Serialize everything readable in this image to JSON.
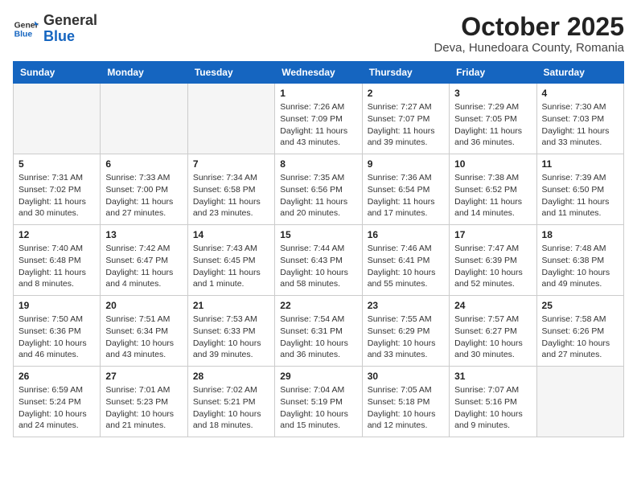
{
  "header": {
    "logo_general": "General",
    "logo_blue": "Blue",
    "month_title": "October 2025",
    "location": "Deva, Hunedoara County, Romania"
  },
  "days_of_week": [
    "Sunday",
    "Monday",
    "Tuesday",
    "Wednesday",
    "Thursday",
    "Friday",
    "Saturday"
  ],
  "weeks": [
    [
      {
        "day": "",
        "info": ""
      },
      {
        "day": "",
        "info": ""
      },
      {
        "day": "",
        "info": ""
      },
      {
        "day": "1",
        "info": "Sunrise: 7:26 AM\nSunset: 7:09 PM\nDaylight: 11 hours and 43 minutes."
      },
      {
        "day": "2",
        "info": "Sunrise: 7:27 AM\nSunset: 7:07 PM\nDaylight: 11 hours and 39 minutes."
      },
      {
        "day": "3",
        "info": "Sunrise: 7:29 AM\nSunset: 7:05 PM\nDaylight: 11 hours and 36 minutes."
      },
      {
        "day": "4",
        "info": "Sunrise: 7:30 AM\nSunset: 7:03 PM\nDaylight: 11 hours and 33 minutes."
      }
    ],
    [
      {
        "day": "5",
        "info": "Sunrise: 7:31 AM\nSunset: 7:02 PM\nDaylight: 11 hours and 30 minutes."
      },
      {
        "day": "6",
        "info": "Sunrise: 7:33 AM\nSunset: 7:00 PM\nDaylight: 11 hours and 27 minutes."
      },
      {
        "day": "7",
        "info": "Sunrise: 7:34 AM\nSunset: 6:58 PM\nDaylight: 11 hours and 23 minutes."
      },
      {
        "day": "8",
        "info": "Sunrise: 7:35 AM\nSunset: 6:56 PM\nDaylight: 11 hours and 20 minutes."
      },
      {
        "day": "9",
        "info": "Sunrise: 7:36 AM\nSunset: 6:54 PM\nDaylight: 11 hours and 17 minutes."
      },
      {
        "day": "10",
        "info": "Sunrise: 7:38 AM\nSunset: 6:52 PM\nDaylight: 11 hours and 14 minutes."
      },
      {
        "day": "11",
        "info": "Sunrise: 7:39 AM\nSunset: 6:50 PM\nDaylight: 11 hours and 11 minutes."
      }
    ],
    [
      {
        "day": "12",
        "info": "Sunrise: 7:40 AM\nSunset: 6:48 PM\nDaylight: 11 hours and 8 minutes."
      },
      {
        "day": "13",
        "info": "Sunrise: 7:42 AM\nSunset: 6:47 PM\nDaylight: 11 hours and 4 minutes."
      },
      {
        "day": "14",
        "info": "Sunrise: 7:43 AM\nSunset: 6:45 PM\nDaylight: 11 hours and 1 minute."
      },
      {
        "day": "15",
        "info": "Sunrise: 7:44 AM\nSunset: 6:43 PM\nDaylight: 10 hours and 58 minutes."
      },
      {
        "day": "16",
        "info": "Sunrise: 7:46 AM\nSunset: 6:41 PM\nDaylight: 10 hours and 55 minutes."
      },
      {
        "day": "17",
        "info": "Sunrise: 7:47 AM\nSunset: 6:39 PM\nDaylight: 10 hours and 52 minutes."
      },
      {
        "day": "18",
        "info": "Sunrise: 7:48 AM\nSunset: 6:38 PM\nDaylight: 10 hours and 49 minutes."
      }
    ],
    [
      {
        "day": "19",
        "info": "Sunrise: 7:50 AM\nSunset: 6:36 PM\nDaylight: 10 hours and 46 minutes."
      },
      {
        "day": "20",
        "info": "Sunrise: 7:51 AM\nSunset: 6:34 PM\nDaylight: 10 hours and 43 minutes."
      },
      {
        "day": "21",
        "info": "Sunrise: 7:53 AM\nSunset: 6:33 PM\nDaylight: 10 hours and 39 minutes."
      },
      {
        "day": "22",
        "info": "Sunrise: 7:54 AM\nSunset: 6:31 PM\nDaylight: 10 hours and 36 minutes."
      },
      {
        "day": "23",
        "info": "Sunrise: 7:55 AM\nSunset: 6:29 PM\nDaylight: 10 hours and 33 minutes."
      },
      {
        "day": "24",
        "info": "Sunrise: 7:57 AM\nSunset: 6:27 PM\nDaylight: 10 hours and 30 minutes."
      },
      {
        "day": "25",
        "info": "Sunrise: 7:58 AM\nSunset: 6:26 PM\nDaylight: 10 hours and 27 minutes."
      }
    ],
    [
      {
        "day": "26",
        "info": "Sunrise: 6:59 AM\nSunset: 5:24 PM\nDaylight: 10 hours and 24 minutes."
      },
      {
        "day": "27",
        "info": "Sunrise: 7:01 AM\nSunset: 5:23 PM\nDaylight: 10 hours and 21 minutes."
      },
      {
        "day": "28",
        "info": "Sunrise: 7:02 AM\nSunset: 5:21 PM\nDaylight: 10 hours and 18 minutes."
      },
      {
        "day": "29",
        "info": "Sunrise: 7:04 AM\nSunset: 5:19 PM\nDaylight: 10 hours and 15 minutes."
      },
      {
        "day": "30",
        "info": "Sunrise: 7:05 AM\nSunset: 5:18 PM\nDaylight: 10 hours and 12 minutes."
      },
      {
        "day": "31",
        "info": "Sunrise: 7:07 AM\nSunset: 5:16 PM\nDaylight: 10 hours and 9 minutes."
      },
      {
        "day": "",
        "info": ""
      }
    ]
  ]
}
